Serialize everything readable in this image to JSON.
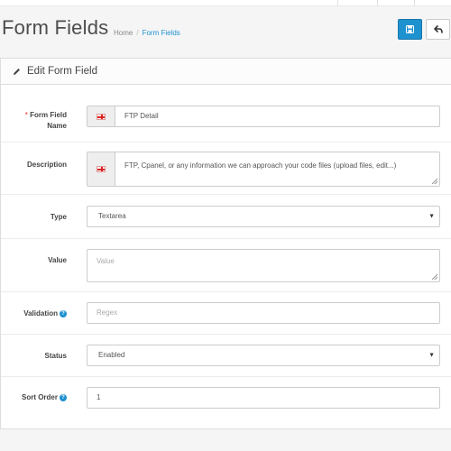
{
  "header": {
    "title": "Form Fields",
    "breadcrumb": {
      "home": "Home",
      "divider": "/",
      "current": "Form Fields"
    },
    "save_icon": "save-icon",
    "back_icon": "reply-icon"
  },
  "panel": {
    "heading": "Edit Form Field",
    "heading_icon": "pencil-icon"
  },
  "form": {
    "name": {
      "required_mark": "*",
      "label_line1": "Form Field",
      "label_line2": "Name",
      "value": "FTP Detail",
      "flag": "uk-flag-icon"
    },
    "description": {
      "label": "Description",
      "value": "FTP, Cpanel, or any information we can approach your code files (upload files, edit...)",
      "flag": "uk-flag-icon"
    },
    "type": {
      "label": "Type",
      "value": "Textarea"
    },
    "value": {
      "label": "Value",
      "placeholder": "Value"
    },
    "validation": {
      "label": "Validation",
      "placeholder": "Regex"
    },
    "status": {
      "label": "Status",
      "value": "Enabled"
    },
    "sort_order": {
      "label": "Sort Order",
      "value": "1"
    }
  },
  "colors": {
    "primary": "#1e91cf",
    "required": "#f56b6b"
  }
}
